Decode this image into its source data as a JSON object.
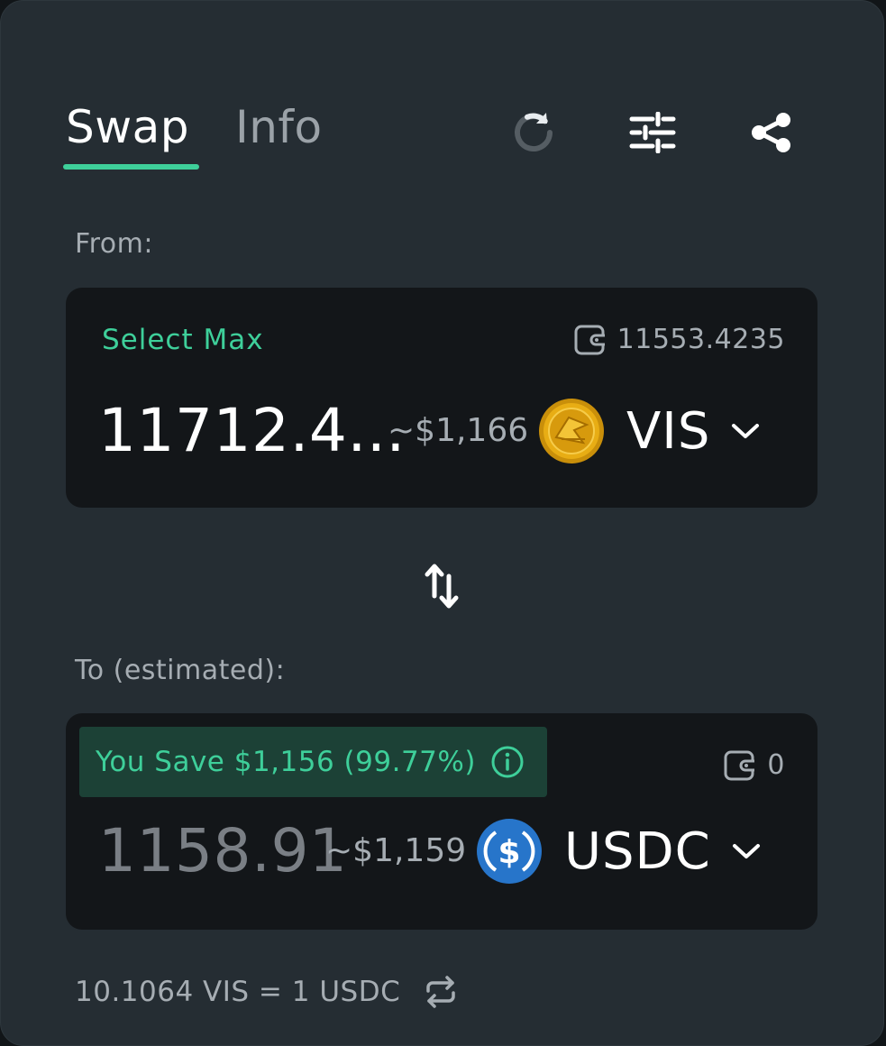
{
  "tabs": {
    "swap": "Swap",
    "info": "Info"
  },
  "from": {
    "label": "From:",
    "select_max": "Select Max",
    "balance": "11553.4235",
    "amount": "11712.4...",
    "usd": "~$1,166",
    "token": "VIS"
  },
  "to": {
    "label": "To (estimated):",
    "save_text": "You Save $1,156 (99.77%)",
    "balance": "0",
    "amount": "1158.91",
    "usd": "~$1,159",
    "token": "USDC"
  },
  "rate": "10.1064 VIS = 1 USDC",
  "icons": {
    "refresh": "refresh-icon",
    "settings": "sliders-icon",
    "share": "share-icon",
    "wallet": "wallet-icon",
    "swap_direction": "swap-arrows-icon",
    "info": "info-icon",
    "chevron": "chevron-down-icon",
    "rate_toggle": "repeat-icon"
  },
  "colors": {
    "accent": "#3ecf9a",
    "panel": "#252d33",
    "card": "#131619",
    "muted_text": "#a6adb3",
    "save_badge_bg": "#1c4136",
    "vis_coin": "#e0a514",
    "usdc_coin": "#2775ca"
  }
}
